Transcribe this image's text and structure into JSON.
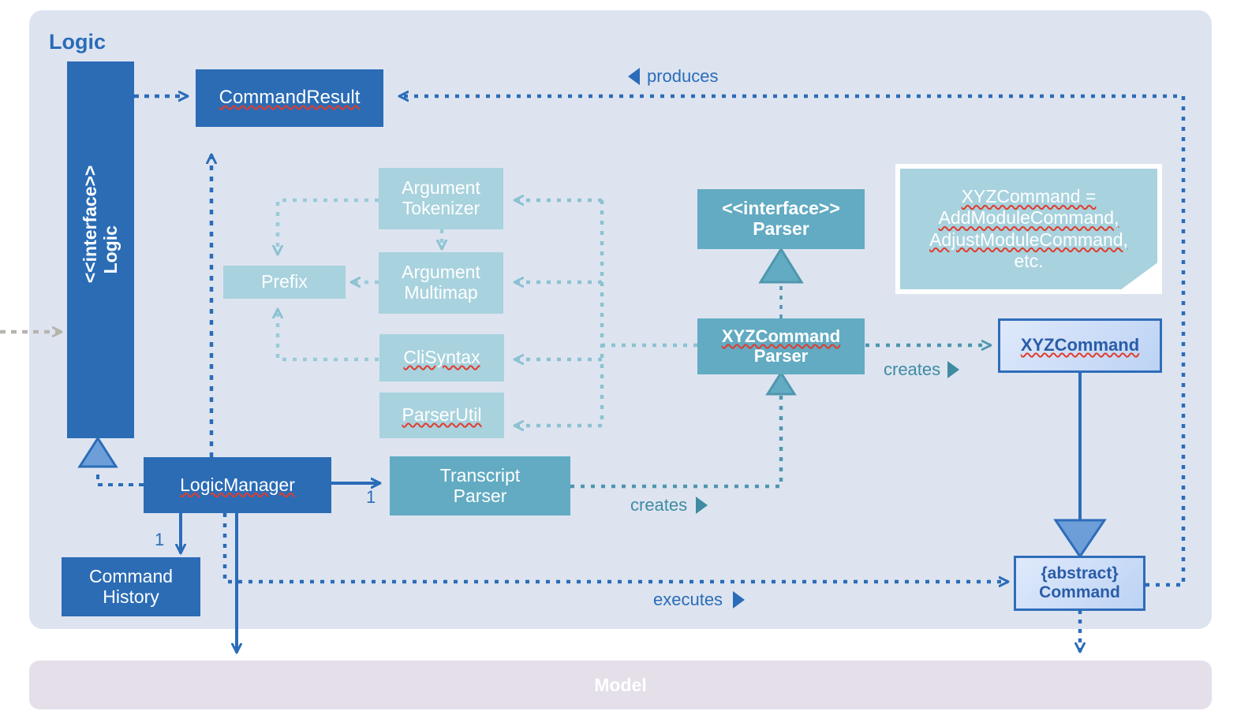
{
  "packages": {
    "logic": {
      "title": "Logic"
    },
    "model": {
      "title": "Model"
    }
  },
  "nodes": {
    "logic_interface": {
      "stereotype": "<<interface>>",
      "name": "Logic"
    },
    "command_result": {
      "name": "CommandResult"
    },
    "argument_tokenizer": {
      "line1": "Argument",
      "line2": "Tokenizer"
    },
    "argument_multimap": {
      "line1": "Argument",
      "line2": "Multimap"
    },
    "prefix": {
      "name": "Prefix"
    },
    "cli_syntax": {
      "name": "CliSyntax"
    },
    "parser_util": {
      "name": "ParserUtil"
    },
    "logic_manager": {
      "name": "LogicManager"
    },
    "transcript_parser": {
      "line1": "Transcript",
      "line2": "Parser"
    },
    "command_history": {
      "line1": "Command",
      "line2": "History"
    },
    "parser_interface": {
      "stereotype": "<<interface>>",
      "name": "Parser"
    },
    "xyz_command_parser": {
      "line1": "XYZCommand",
      "line2": "Parser"
    },
    "xyz_command": {
      "name": "XYZCommand"
    },
    "abstract_command": {
      "stereotype": "{abstract}",
      "name": "Command"
    }
  },
  "note": {
    "line1": "XYZCommand =",
    "line2": "AddModuleCommand,",
    "line3": "AdjustModuleCommand,",
    "line4": "etc."
  },
  "edge_labels": {
    "produces": "produces",
    "creates_parser": "creates",
    "creates_transcript": "creates",
    "executes": "executes"
  },
  "multiplicities": {
    "transcript_parser": "1",
    "command_history": "1"
  },
  "colors": {
    "panel_logic": "#dde4f0",
    "panel_model": "#e4dfe9",
    "node_dark_blue": "#2b6cb5",
    "node_teal": "#62abc2",
    "node_light_blue": "#a8d2de",
    "border_accent": "#2f6cba",
    "edge_blue": "#2a6cb8",
    "edge_teal": "#8cc2d2",
    "spellcheck_red": "#e03c2e"
  }
}
